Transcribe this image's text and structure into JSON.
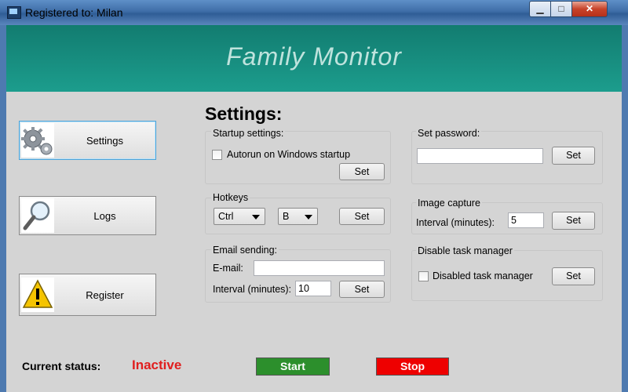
{
  "window": {
    "title": "Registered to: Milan",
    "min_glyph": "▁",
    "max_glyph": "□",
    "close_glyph": "✕"
  },
  "banner": {
    "title": "Family Monitor"
  },
  "nav": {
    "settings": "Settings",
    "logs": "Logs",
    "register": "Register"
  },
  "settings": {
    "heading": "Settings:",
    "startup": {
      "title": "Startup settings:",
      "autorun_label": "Autorun on Windows startup",
      "autorun_checked": false,
      "set": "Set"
    },
    "hotkeys": {
      "title": "Hotkeys",
      "modifier": "Ctrl",
      "key": "B",
      "set": "Set"
    },
    "email": {
      "title": "Email sending:",
      "email_label": "E-mail:",
      "email_value": "",
      "interval_label": "Interval (minutes):",
      "interval_value": "10",
      "set": "Set"
    },
    "password": {
      "title": "Set password:",
      "value": "",
      "set": "Set"
    },
    "image_capture": {
      "title": "Image capture",
      "interval_label": "Interval (minutes):",
      "interval_value": "5",
      "set": "Set"
    },
    "task_manager": {
      "title": "Disable task manager",
      "label": "Disabled task manager",
      "checked": false,
      "set": "Set"
    }
  },
  "status": {
    "label": "Current status:",
    "value": "Inactive",
    "value_color": "#e01e1e"
  },
  "actions": {
    "start": "Start",
    "stop": "Stop",
    "start_color": "#2c8f2c",
    "stop_color": "#ee0000"
  }
}
